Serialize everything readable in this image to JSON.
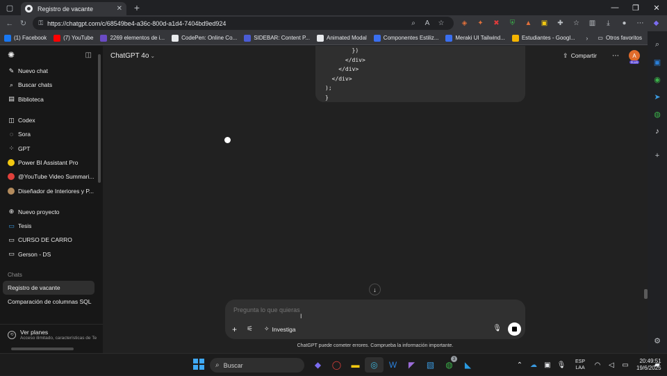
{
  "browser": {
    "tab_title": "Registro de vacante",
    "url": "https://chatgpt.com/c/68549be4-a36c-800d-a1d4-7404bd9ed924",
    "bookmarks": [
      {
        "label": "(1) Facebook",
        "color": "#1877f2"
      },
      {
        "label": "(7) YouTube",
        "color": "#ff0000"
      },
      {
        "label": "2269 elementos de i...",
        "color": "#6a4bc4"
      },
      {
        "label": "CodePen: Online Co...",
        "color": "#e8eaed"
      },
      {
        "label": "SIDEBAR: Content P...",
        "color": "#4a5cd6"
      },
      {
        "label": "Animated Modal",
        "color": "#e8eaed"
      },
      {
        "label": "Componentes Estiliz...",
        "color": "#3a6ff0"
      },
      {
        "label": "Meraki UI Tailwind...",
        "color": "#3a6ff0"
      },
      {
        "label": "Estudiantes - Googl...",
        "color": "#f4b400"
      }
    ],
    "other_bookmarks": "Otros favoritos"
  },
  "sidebar": {
    "main_items": [
      {
        "label": "Nuevo chat",
        "icon": "✎"
      },
      {
        "label": "Buscar chats",
        "icon": "⌕"
      },
      {
        "label": "Biblioteca",
        "icon": "▤"
      }
    ],
    "tool_items": [
      {
        "label": "Codex",
        "icon": "◫"
      },
      {
        "label": "Sora",
        "icon": "◌"
      },
      {
        "label": "GPT",
        "icon": "⁘"
      }
    ],
    "gpts": [
      {
        "label": "Power BI Assistant Pro",
        "color": "#f2c811"
      },
      {
        "label": "@YouTube Video Summari...",
        "color": "#e0403b"
      },
      {
        "label": "Diseñador de Interiores y P...",
        "color": "#b38b5d"
      }
    ],
    "projects": [
      {
        "label": "Nuevo proyecto",
        "icon": "⊕"
      },
      {
        "label": "Tesis",
        "icon": "▭"
      },
      {
        "label": "CURSO DE CARRO",
        "icon": "▭"
      },
      {
        "label": "Gerson - DS",
        "icon": "▭"
      }
    ],
    "chats_label": "Chats",
    "chats": [
      {
        "label": "Registro de vacante"
      },
      {
        "label": "Comparación de columnas SQL"
      }
    ],
    "plans_title": "Ver planes",
    "plans_subtitle": "Acceso ilimitado, características de Te"
  },
  "main": {
    "model": "ChatGPT 4o",
    "share": "Compartir",
    "avatar_letter": "A",
    "avatar_badge": "PLUS",
    "code_lines": [
      "        })",
      "      </div>",
      "    </div>",
      "  </div>",
      ");",
      "}"
    ],
    "composer_placeholder": "Pregunta lo que quieras",
    "investiga": "Investiga",
    "disclaimer": "ChatGPT puede cometer errores. Comprueba la información importante."
  },
  "taskbar": {
    "search": "Buscar",
    "lang_top": "ESP",
    "lang_bottom": "LAA",
    "time": "20:49:51",
    "date": "19/6/2025",
    "whatsapp_badge": "3"
  }
}
